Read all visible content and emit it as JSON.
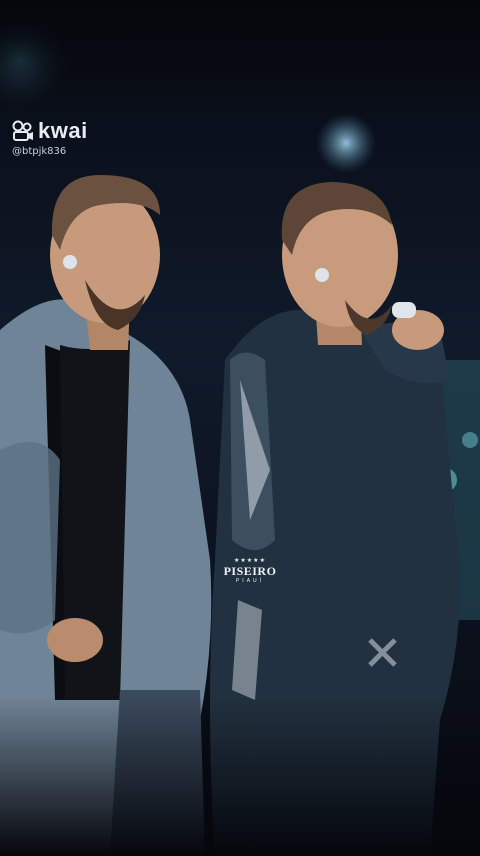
{
  "watermark": {
    "brand": "kwai",
    "username": "@btpjk836"
  },
  "logo": {
    "stars": "★★★★★",
    "name": "PISEIRO",
    "sub": "PIAUÍ"
  },
  "colors": {
    "background": "#0a0d16",
    "stage_light": "#3f6f8a",
    "jacket_left": "#6f8496",
    "jacket_right": "#22313f",
    "skin": "#c79a7c"
  },
  "icons": [
    "kwai-logo-icon",
    "earpiece-icon",
    "microphone-icon"
  ]
}
